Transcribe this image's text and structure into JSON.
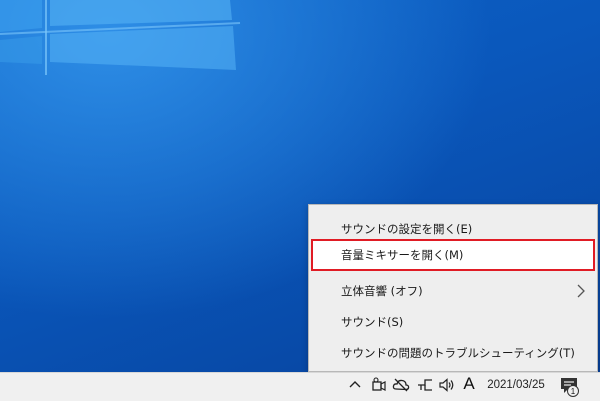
{
  "context_menu": {
    "items": [
      {
        "label": "サウンドの設定を開く(E)"
      },
      {
        "label": "音量ミキサーを開く(M)",
        "highlighted": true
      },
      {
        "label": "立体音響 (オフ)",
        "has_submenu": true
      },
      {
        "label": "サウンド(S)"
      },
      {
        "label": "サウンドの問題のトラブルシューティング(T)"
      }
    ],
    "highlight_color": "#e01b24"
  },
  "taskbar": {
    "tray_icons": [
      "chevron-up-icon",
      "meet-now-icon",
      "cloud-offline-icon",
      "network-icon",
      "speaker-icon"
    ],
    "ime_indicator": "A",
    "clock_date": "2021/03/25",
    "notification_count": "1"
  },
  "desktop": {
    "background_color": "#0a57bb",
    "taskbar_color": "#f0f0f0"
  }
}
